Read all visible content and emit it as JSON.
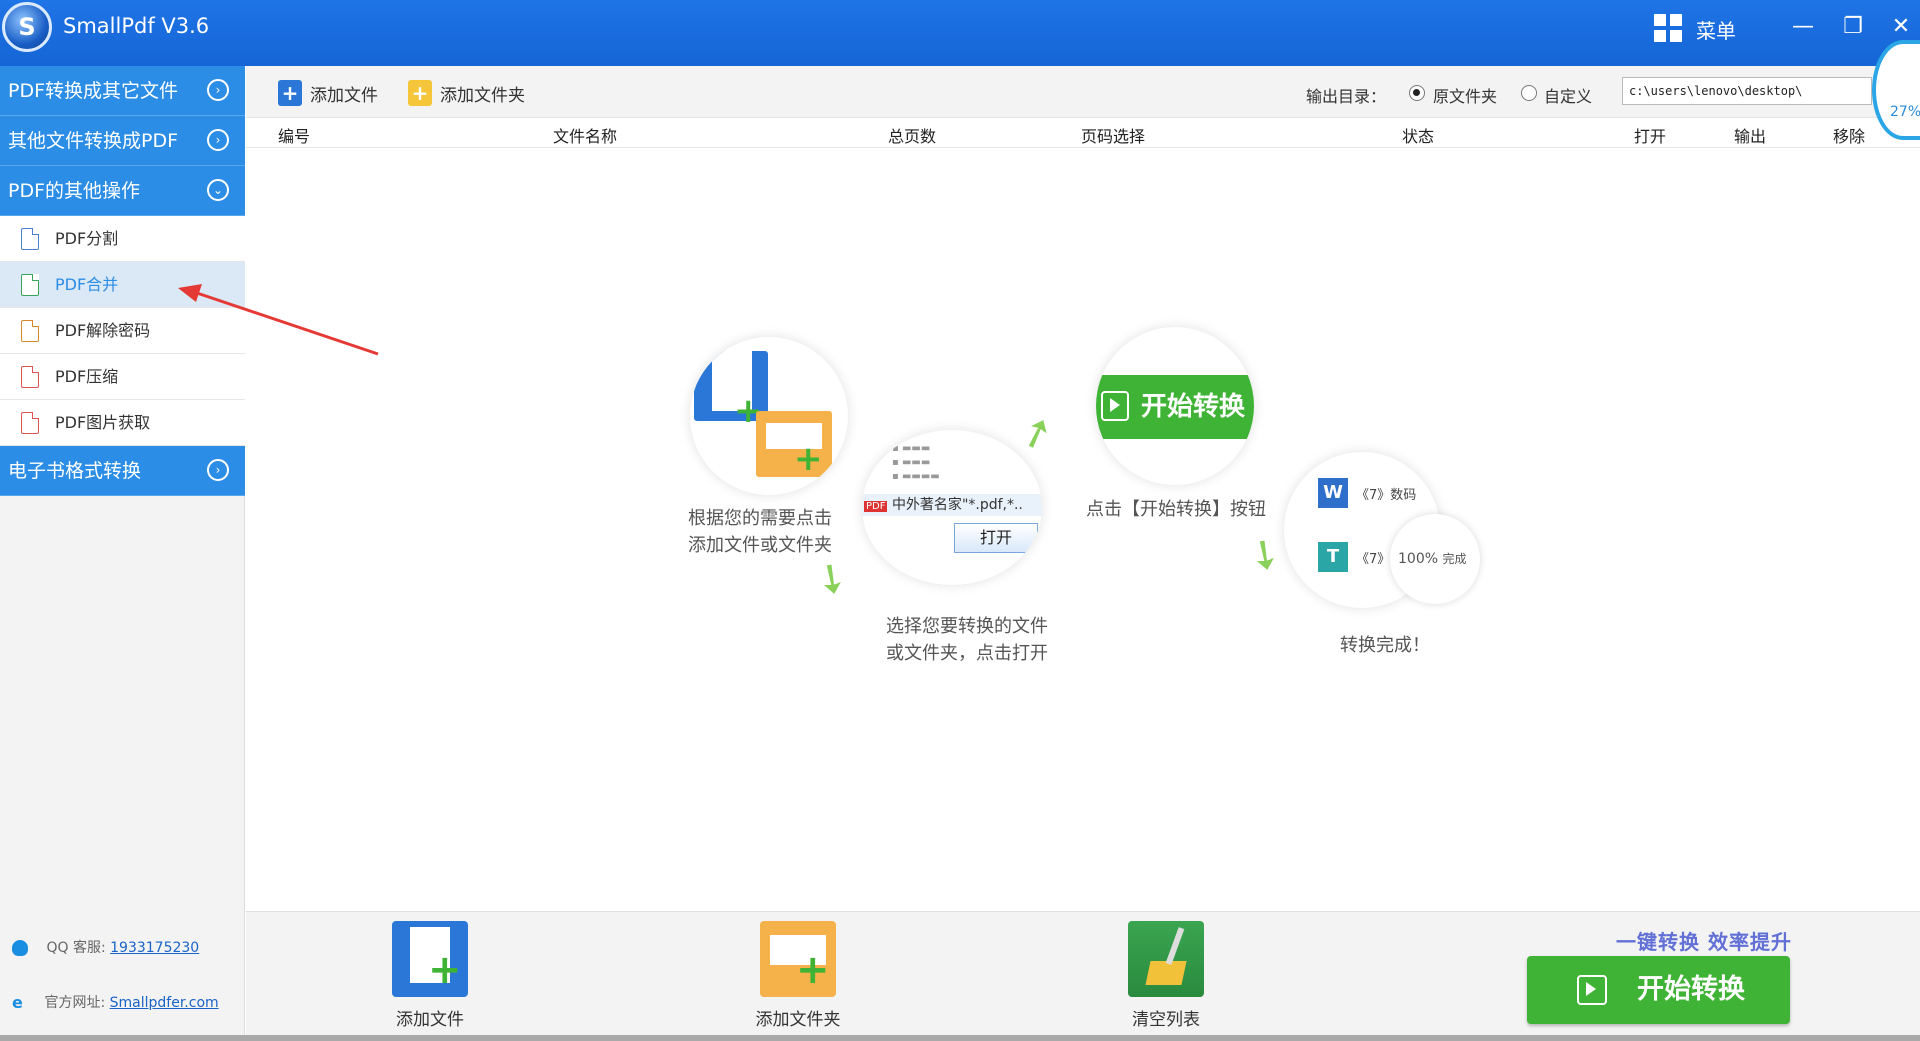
{
  "app": {
    "title": "SmallPdf V3.6",
    "logo_letter": "S",
    "menu_label": "菜单"
  },
  "window_controls": {
    "minimize": "—",
    "restore": "❐",
    "close": "✕"
  },
  "sidebar": {
    "categories": [
      {
        "label": "PDF转换成其它文件",
        "chevron": "›"
      },
      {
        "label": "其他文件转换成PDF",
        "chevron": "›"
      },
      {
        "label": "PDF的其他操作",
        "chevron": "⌄"
      },
      {
        "label": "电子书格式转换",
        "chevron": "›"
      }
    ],
    "items": [
      {
        "label": "PDF分割",
        "icon": "pdf-file-icon",
        "color": "#4a7fd1"
      },
      {
        "label": "PDF合并",
        "icon": "pdf-file-icon",
        "color": "#3aa55a",
        "active": true
      },
      {
        "label": "PDF解除密码",
        "icon": "pdf-file-icon",
        "color": "#d68a2a"
      },
      {
        "label": "PDF压缩",
        "icon": "pdf-file-icon",
        "color": "#e05555"
      },
      {
        "label": "PDF图片获取",
        "icon": "pdf-file-icon",
        "color": "#e05555"
      }
    ],
    "footer": {
      "qq_label": "QQ 客服:",
      "qq_number": "1933175230",
      "site_label": "官方网址:",
      "site_url": "Smallpdfer.com"
    }
  },
  "toolbar": {
    "add_file": "添加文件",
    "add_folder": "添加文件夹",
    "output_dir_label": "输出目录：",
    "radio_original": "原文件夹",
    "radio_custom": "自定义",
    "path_value": "c:\\users\\lenovo\\desktop\\"
  },
  "gauge": {
    "percent_text": "27%"
  },
  "table": {
    "columns": [
      "编号",
      "文件名称",
      "总页数",
      "页码选择",
      "状态",
      "打开",
      "输出",
      "移除"
    ]
  },
  "guide": {
    "step1": "根据您的需要点击\n添加文件或文件夹",
    "step2": "选择您要转换的文件\n或文件夹，点击打开",
    "step2_pdf_badge": "PDF",
    "step2_filename": "中外著名家",
    "step2_filter": "\"*.pdf,*..",
    "step2_open": "打开",
    "step3_button": "开始转换",
    "step3": "点击【开始转换】按钮",
    "step4_row1": "《7》数码",
    "step4_row2": "《7》",
    "step4_progress": "100%",
    "step4_done": "完成",
    "step4": "转换完成！"
  },
  "bottom": {
    "add_file": "添加文件",
    "add_folder": "添加文件夹",
    "clear_list": "清空列表",
    "slogan": "一键转换  效率提升",
    "start": "开始转换"
  },
  "colors": {
    "brand_blue": "#2b8de5",
    "title_blue": "#1f74e6",
    "start_green": "#3fb335",
    "annotation_red": "#e53935"
  }
}
